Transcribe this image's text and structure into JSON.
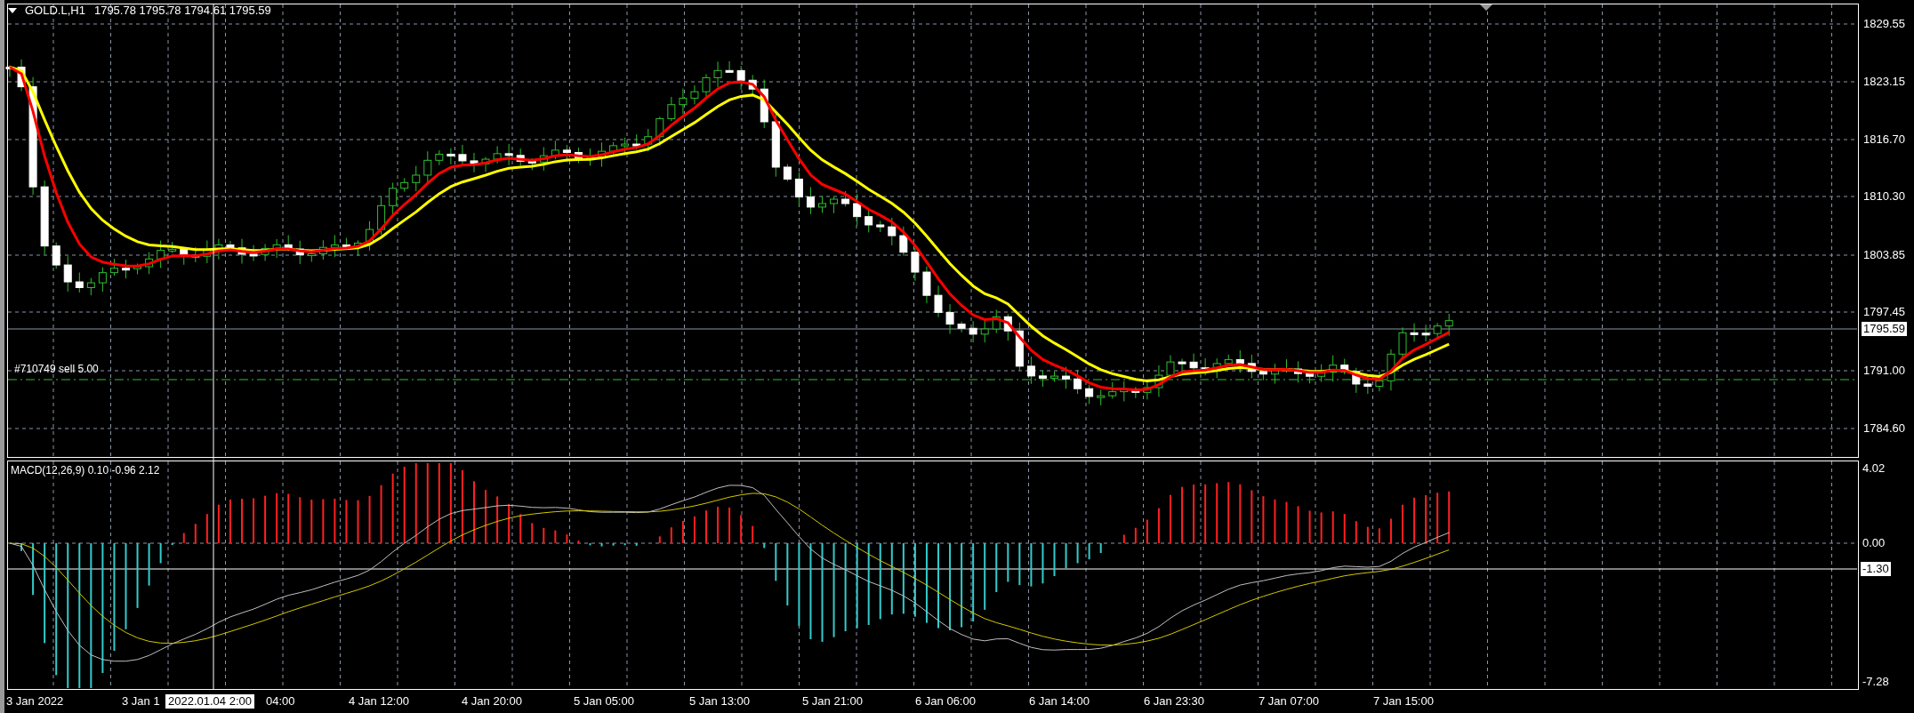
{
  "header": {
    "symbol": "GOLD.L,H1",
    "quote": "1795.78 1795.78 1794.61 1795.59"
  },
  "price_axis": [
    {
      "label": "1829.55",
      "kind": "tick"
    },
    {
      "label": "1823.15",
      "kind": "tick"
    },
    {
      "label": "1816.70",
      "kind": "tick"
    },
    {
      "label": "1810.30",
      "kind": "tick"
    },
    {
      "label": "1803.85",
      "kind": "tick"
    },
    {
      "label": "1797.45",
      "kind": "tick"
    },
    {
      "label": "1795.59",
      "kind": "current"
    },
    {
      "label": "1791.00",
      "kind": "tick"
    },
    {
      "label": "1784.60",
      "kind": "tick"
    }
  ],
  "order_label": "#710749 sell 5.00",
  "indicator": {
    "label": "MACD(12,26,9) 0.10 -0.96 2.12"
  },
  "indicator_axis": [
    {
      "label": "4.02",
      "kind": "tick"
    },
    {
      "label": "0.00",
      "kind": "tick"
    },
    {
      "label": "-1.30",
      "kind": "current"
    },
    {
      "label": "-7.28",
      "kind": "tick"
    }
  ],
  "time_axis": [
    {
      "label": "3 Jan 2022",
      "kind": "tick"
    },
    {
      "label": "3 Jan 1",
      "kind": "tick"
    },
    {
      "label": "2022.01.04 2:00",
      "kind": "crosshair"
    },
    {
      "label": "04:00",
      "kind": "tick"
    },
    {
      "label": "4 Jan 12:00",
      "kind": "tick"
    },
    {
      "label": "4 Jan 20:00",
      "kind": "tick"
    },
    {
      "label": "5 Jan 05:00",
      "kind": "tick"
    },
    {
      "label": "5 Jan 13:00",
      "kind": "tick"
    },
    {
      "label": "5 Jan 21:00",
      "kind": "tick"
    },
    {
      "label": "6 Jan 06:00",
      "kind": "tick"
    },
    {
      "label": "6 Jan 14:00",
      "kind": "tick"
    },
    {
      "label": "6 Jan 23:30",
      "kind": "tick"
    },
    {
      "label": "7 Jan 07:00",
      "kind": "tick"
    },
    {
      "label": "7 Jan 15:00",
      "kind": "tick"
    }
  ]
}
